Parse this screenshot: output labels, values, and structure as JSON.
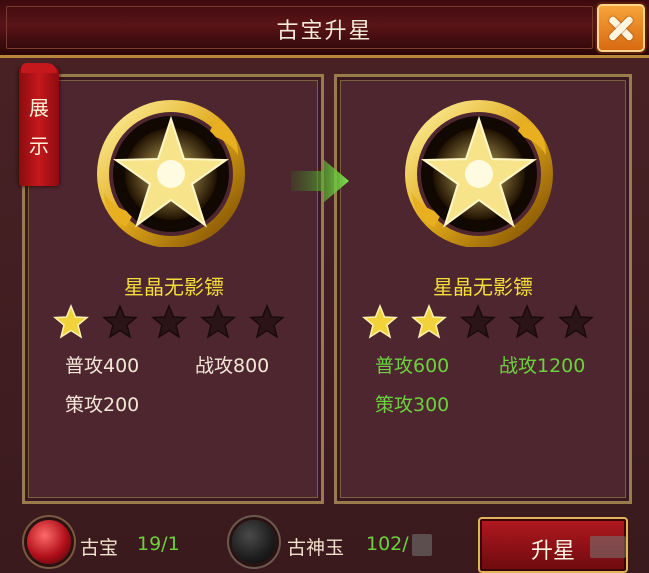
{
  "dialog": {
    "title": "古宝升星",
    "close_icon": "close-x-icon"
  },
  "ribbon": {
    "chars": [
      "展",
      "示"
    ]
  },
  "current": {
    "name": "星晶无影镖",
    "stars_lit": 1,
    "stars_total": 5,
    "stats": [
      {
        "label": "普攻400"
      },
      {
        "label": "战攻800"
      },
      {
        "label": "策攻200"
      }
    ]
  },
  "next": {
    "name": "星晶无影镖",
    "stars_lit": 2,
    "stars_total": 5,
    "stats": [
      {
        "label": "普攻600"
      },
      {
        "label": "战攻1200"
      },
      {
        "label": "策攻300"
      }
    ]
  },
  "resources": [
    {
      "label": "古宝",
      "value": "19/1",
      "icon": "red-orb-icon"
    },
    {
      "label": "古神玉",
      "value": "102/",
      "icon": "dark-orb-icon"
    }
  ],
  "upgrade_button": {
    "label": "升星"
  },
  "colors": {
    "stat_green": "#6bd13e",
    "name_yellow": "#f3dd3a",
    "star_gold": "#f2d23a"
  }
}
